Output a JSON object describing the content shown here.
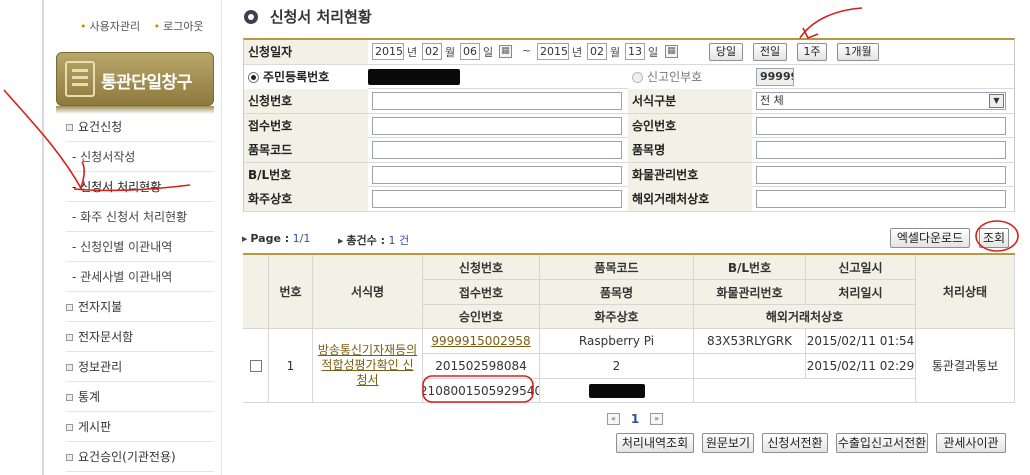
{
  "sidebar": {
    "top_links": [
      "사용자관리",
      "로그아웃"
    ],
    "banner_title": "통관단일창구",
    "menu": [
      {
        "label": "요건신청",
        "type": "section"
      },
      {
        "label": "- 신청서작성",
        "type": "sub"
      },
      {
        "label": "- 신청서 처리현황",
        "type": "sub",
        "active": true
      },
      {
        "label": "- 화주 신청서 처리현황",
        "type": "sub"
      },
      {
        "label": "- 신청인별 이관내역",
        "type": "sub"
      },
      {
        "label": "- 관세사별 이관내역",
        "type": "sub"
      },
      {
        "label": "전자지불",
        "type": "section"
      },
      {
        "label": "전자문서함",
        "type": "section"
      },
      {
        "label": "정보관리",
        "type": "section"
      },
      {
        "label": "통계",
        "type": "section"
      },
      {
        "label": "게시판",
        "type": "section"
      },
      {
        "label": "요건승인(기관전용)",
        "type": "section"
      }
    ]
  },
  "main": {
    "title": "신청서 처리현황",
    "search": {
      "date_label": "신청일자",
      "from": {
        "year": "2015",
        "month": "02",
        "day": "06"
      },
      "to": {
        "year": "2015",
        "month": "02",
        "day": "13"
      },
      "unit_year": "년",
      "unit_month": "월",
      "unit_day": "일",
      "range_sep": "~",
      "quick_buttons": [
        "당일",
        "전일",
        "1주",
        "1개월"
      ],
      "radio_resident": "주민등록번호",
      "radio_reporter": "신고인부호",
      "reporter_code": "99999",
      "fields": {
        "app_no": "신청번호",
        "form_type": "서식구분",
        "form_type_value": "전 체",
        "receipt_no": "접수번호",
        "approval_no": "승인번호",
        "item_code": "품목코드",
        "item_name": "품목명",
        "bl_no": "B/L번호",
        "cargo_no": "화물관리번호",
        "consignee": "화주상호",
        "overseas": "해외거래처상호"
      }
    },
    "info": {
      "page_label": "Page :",
      "page_value": "1/1",
      "total_label": "총건수 :",
      "total_value": "1 건",
      "excel_button": "엑셀다운로드",
      "search_button": "조회"
    },
    "table": {
      "headers": {
        "no": "번호",
        "form_name": "서식명",
        "app_no": "신청번호",
        "receipt_no": "접수번호",
        "approval_no": "승인번호",
        "item_code": "품목코드",
        "item_name": "품목명",
        "consignee": "화주상호",
        "bl_no": "B/L번호",
        "cargo_no": "화물관리번호",
        "overseas": "해외거래처상호",
        "report_date": "신고일시",
        "process_date": "처리일시",
        "status": "처리상태"
      },
      "row": {
        "no": "1",
        "form_name": "방송통신기자재등의 적합성평가확인 신청서",
        "app_no": "9999915002958",
        "receipt_no": "201502598084",
        "approval_no": "2108001505929540",
        "item_code": "Raspberry Pi",
        "item_name": "2",
        "bl_no": "83X53RLYGRK",
        "report_date": "2015/02/11 01:54",
        "process_date": "2015/02/11 02:29",
        "status": "통관결과통보"
      }
    },
    "pager": {
      "current": "1",
      "prev": "«",
      "next": "»"
    },
    "bottom_buttons": [
      "처리내역조회",
      "원문보기",
      "신청서전환",
      "수출입신고서전환",
      "관세사이관"
    ]
  }
}
